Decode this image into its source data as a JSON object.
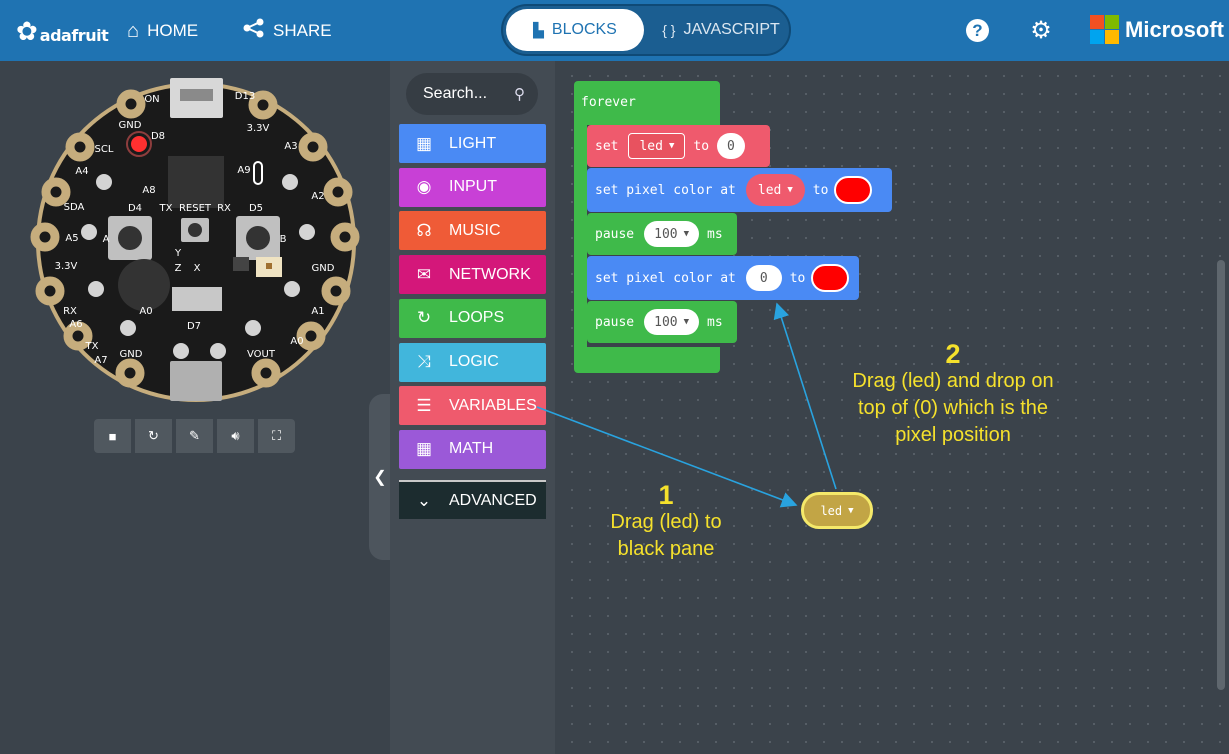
{
  "topbar": {
    "brand": "adafruit",
    "home_label": "HOME",
    "share_label": "SHARE",
    "blocks_label": "BLOCKS",
    "javascript_label": "JAVASCRIPT",
    "help_glyph": "?",
    "vendor": "Microsoft"
  },
  "board": {
    "labels": {
      "gnd_top": "GND",
      "on": "ON",
      "d13": "D13",
      "scl": "SCL",
      "a4": "A4",
      "d8": "D8",
      "v33_top": "3.3V",
      "a3": "A3",
      "a9": "A9",
      "sda": "SDA",
      "a5": "A5",
      "a8": "A8",
      "a2": "A2",
      "d4": "D4",
      "tx": "TX",
      "reset": "RESET",
      "rx": "RX",
      "d5": "D5",
      "a_btn": "A",
      "b_btn": "B",
      "v33_left": "3.3V",
      "gnd_right": "GND",
      "y": "Y",
      "z": "Z",
      "x": "X",
      "rx_left": "RX",
      "a6": "A6",
      "a1": "A1",
      "a0_center": "A0",
      "tx_left": "TX",
      "a7": "A7",
      "d7": "D7",
      "a0_right": "A0",
      "gnd_bottom": "GND",
      "vout": "VOUT"
    }
  },
  "sim_controls": [
    "stop-icon",
    "restart-icon",
    "debug-icon",
    "mute-icon",
    "fullscreen-icon"
  ],
  "toolbox": {
    "search_placeholder": "Search...",
    "categories": [
      {
        "label": "LIGHT",
        "color": "#4a8af4",
        "icon": "grid-icon"
      },
      {
        "label": "INPUT",
        "color": "#c840d6",
        "icon": "target-icon"
      },
      {
        "label": "MUSIC",
        "color": "#ef5b37",
        "icon": "headphones-icon"
      },
      {
        "label": "NETWORK",
        "color": "#d4177a",
        "icon": "chat-icon"
      },
      {
        "label": "LOOPS",
        "color": "#3fba4a",
        "icon": "loop-icon"
      },
      {
        "label": "LOGIC",
        "color": "#41b6dc",
        "icon": "shuffle-icon"
      },
      {
        "label": "VARIABLES",
        "color": "#ef5a6d",
        "icon": "list-icon"
      },
      {
        "label": "MATH",
        "color": "#9b59d8",
        "icon": "calculator-icon"
      }
    ],
    "advanced_label": "ADVANCED"
  },
  "workspace": {
    "forever_label": "forever",
    "set_label": "set",
    "set_var": "led",
    "to_label": "to",
    "set_value": "0",
    "pixel_label": "set pixel color at",
    "pixel_var": "led",
    "pixel_to": "to",
    "pause_label": "pause",
    "pause_value": "100",
    "ms_label": "ms",
    "pixel2_index": "0",
    "pixel2_to": "to",
    "pause2_label": "pause",
    "pause2_value": "100",
    "ms2_label": "ms",
    "floating_var": "led",
    "pixel_color": "#ff0000"
  },
  "annotations": {
    "step1_number": "1",
    "step1_text_line1": "Drag (led) to",
    "step1_text_line2": "black pane",
    "step2_number": "2",
    "step2_text_line1": "Drag (led) and drop on",
    "step2_text_line2": "top of (0) which is the",
    "step2_text_line3": "pixel position",
    "color": "#f5e12c",
    "arrow_color": "#29a3df"
  }
}
